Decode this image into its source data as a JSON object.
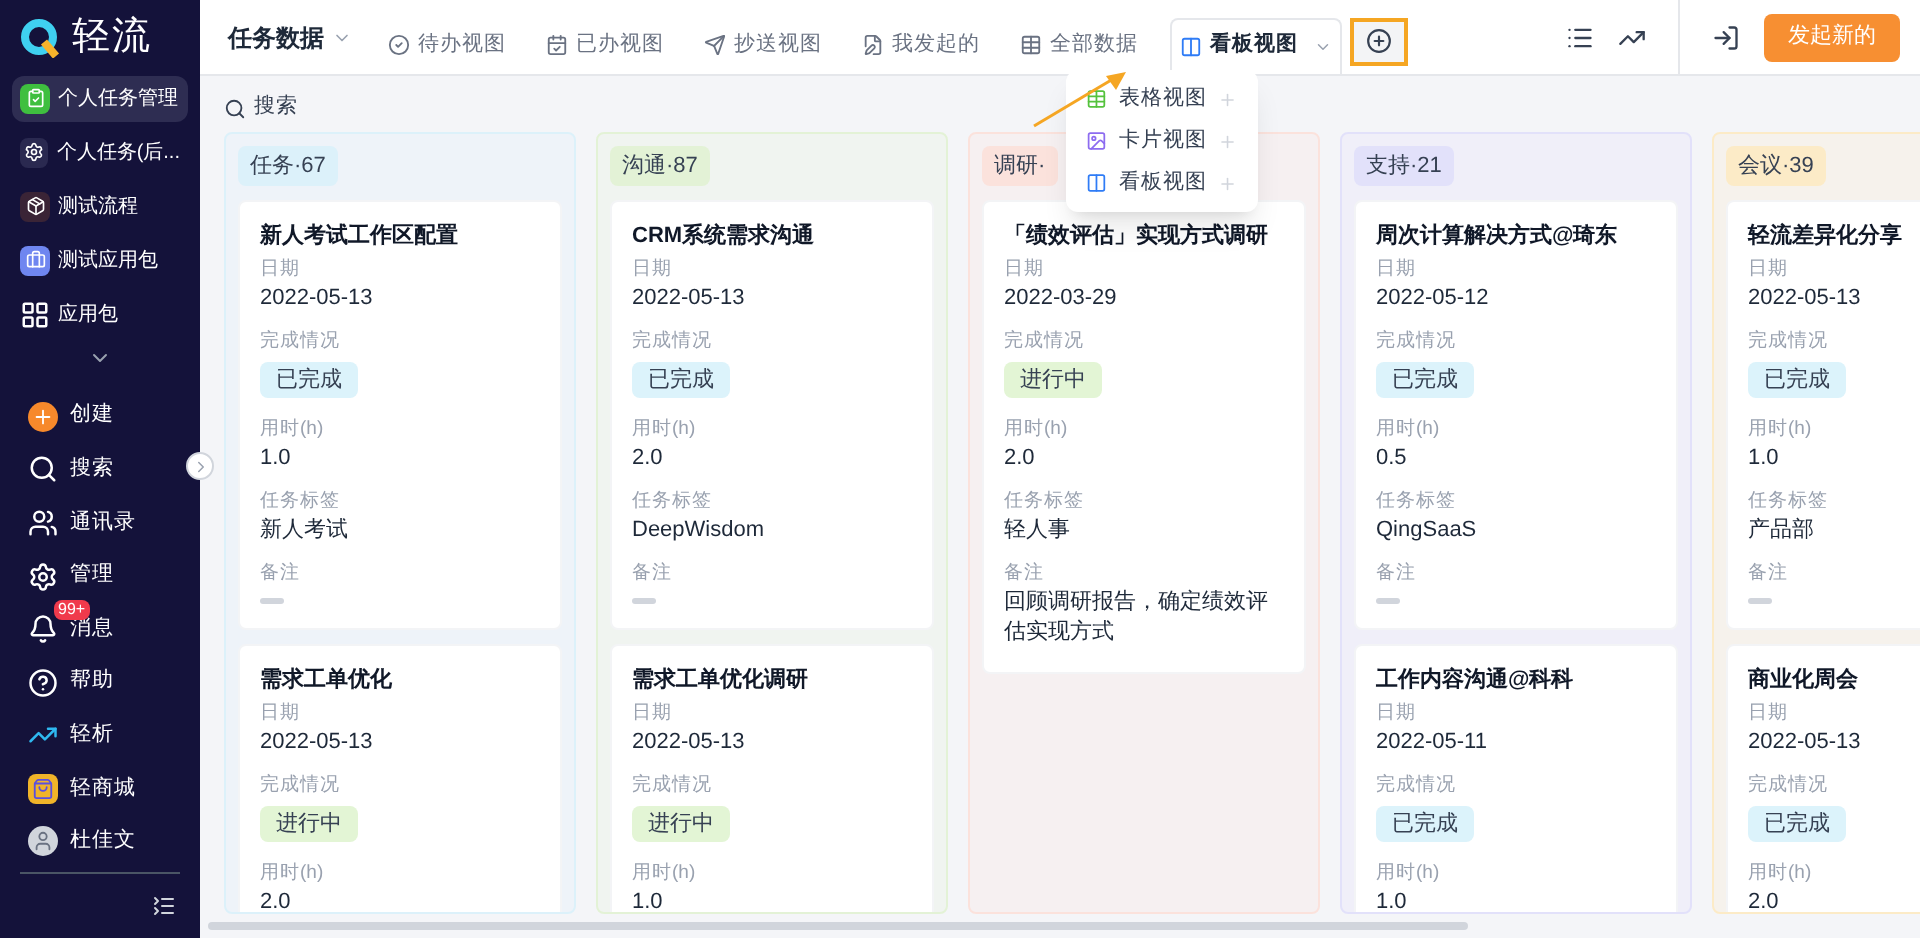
{
  "logo": {
    "text": "轻流"
  },
  "sidebar": {
    "items": [
      {
        "label": "个人任务管理",
        "kind": "app",
        "selected": true
      },
      {
        "label": "个人任务(后...",
        "kind": "app",
        "selected": false
      },
      {
        "label": "测试流程",
        "kind": "app",
        "selected": false
      },
      {
        "label": "测试应用包",
        "kind": "app",
        "selected": false
      },
      {
        "label": "应用包",
        "kind": "nav",
        "selected": false
      }
    ],
    "nav": [
      {
        "label": "创建"
      },
      {
        "label": "搜索"
      },
      {
        "label": "通讯录"
      },
      {
        "label": "管理"
      },
      {
        "label": "消息",
        "badge": "99+"
      },
      {
        "label": "帮助"
      },
      {
        "label": "轻析"
      },
      {
        "label": "轻商城"
      },
      {
        "label": "杜佳文"
      }
    ]
  },
  "toolbar": {
    "title": "任务数据",
    "tabs": [
      {
        "label": "待办视图",
        "selected": false
      },
      {
        "label": "已办视图",
        "selected": false
      },
      {
        "label": "抄送视图",
        "selected": false
      },
      {
        "label": "我发起的",
        "selected": false
      },
      {
        "label": "全部数据",
        "selected": false
      },
      {
        "label": "看板视图",
        "selected": true
      }
    ],
    "primary_button": "发起新的"
  },
  "add_view_menu": {
    "items": [
      {
        "label": "表格视图"
      },
      {
        "label": "卡片视图"
      },
      {
        "label": "看板视图"
      }
    ]
  },
  "search": {
    "placeholder": "搜索"
  },
  "board": {
    "columns": [
      {
        "label": "任务·67",
        "color": "#dcf1fa",
        "cards": [
          {
            "title": "新人考试工作区配置",
            "fields": [
              {
                "label": "日期",
                "value": "2022-05-13",
                "kind": "text"
              },
              {
                "label": "完成情况",
                "value": "已完成",
                "kind": "status",
                "color": "#dcf3fb"
              },
              {
                "label": "用时(h)",
                "value": "1.0",
                "kind": "text"
              },
              {
                "label": "任务标签",
                "value": "新人考试",
                "kind": "text"
              },
              {
                "label": "备注",
                "kind": "empty"
              }
            ]
          },
          {
            "title": "需求工单优化",
            "fields": [
              {
                "label": "日期",
                "value": "2022-05-13",
                "kind": "text"
              },
              {
                "label": "完成情况",
                "value": "进行中",
                "kind": "status",
                "color": "#e3f5d5"
              },
              {
                "label": "用时(h)",
                "value": "2.0",
                "kind": "text"
              }
            ]
          }
        ]
      },
      {
        "label": "沟通·87",
        "color": "#e3f2d6",
        "cards": [
          {
            "title": "CRM系统需求沟通",
            "fields": [
              {
                "label": "日期",
                "value": "2022-05-13",
                "kind": "text"
              },
              {
                "label": "完成情况",
                "value": "已完成",
                "kind": "status",
                "color": "#dcf3fb"
              },
              {
                "label": "用时(h)",
                "value": "2.0",
                "kind": "text"
              },
              {
                "label": "任务标签",
                "value": "DeepWisdom",
                "kind": "text"
              },
              {
                "label": "备注",
                "kind": "empty"
              }
            ]
          },
          {
            "title": "需求工单优化调研",
            "fields": [
              {
                "label": "日期",
                "value": "2022-05-13",
                "kind": "text"
              },
              {
                "label": "完成情况",
                "value": "进行中",
                "kind": "status",
                "color": "#e3f5d5"
              },
              {
                "label": "用时(h)",
                "value": "1.0",
                "kind": "text"
              }
            ]
          }
        ]
      },
      {
        "label": "调研·",
        "color": "#fbe2dc",
        "cards": [
          {
            "title": "「绩效评估」实现方式调研",
            "fields": [
              {
                "label": "日期",
                "value": "2022-03-29",
                "kind": "text"
              },
              {
                "label": "完成情况",
                "value": "进行中",
                "kind": "status",
                "color": "#e3f5d5"
              },
              {
                "label": "用时(h)",
                "value": "2.0",
                "kind": "text"
              },
              {
                "label": "任务标签",
                "value": "轻人事",
                "kind": "text"
              },
              {
                "label": "备注",
                "value": "回顾调研报告，确定绩效评估实现方式",
                "kind": "text"
              }
            ]
          }
        ]
      },
      {
        "label": "支持·21",
        "color": "#e2e1fa",
        "cards": [
          {
            "title": "周次计算解决方式@琦东",
            "fields": [
              {
                "label": "日期",
                "value": "2022-05-12",
                "kind": "text"
              },
              {
                "label": "完成情况",
                "value": "已完成",
                "kind": "status",
                "color": "#dcf3fb"
              },
              {
                "label": "用时(h)",
                "value": "0.5",
                "kind": "text"
              },
              {
                "label": "任务标签",
                "value": "QingSaaS",
                "kind": "text"
              },
              {
                "label": "备注",
                "kind": "empty"
              }
            ]
          },
          {
            "title": "工作内容沟通@科科",
            "fields": [
              {
                "label": "日期",
                "value": "2022-05-11",
                "kind": "text"
              },
              {
                "label": "完成情况",
                "value": "已完成",
                "kind": "status",
                "color": "#dcf3fb"
              },
              {
                "label": "用时(h)",
                "value": "1.0",
                "kind": "text"
              }
            ]
          }
        ]
      },
      {
        "label": "会议·39",
        "color": "#fcebc7",
        "cards": [
          {
            "title": "轻流差异化分享",
            "fields": [
              {
                "label": "日期",
                "value": "2022-05-13",
                "kind": "text"
              },
              {
                "label": "完成情况",
                "value": "已完成",
                "kind": "status",
                "color": "#dcf3fb"
              },
              {
                "label": "用时(h)",
                "value": "1.0",
                "kind": "text"
              },
              {
                "label": "任务标签",
                "value": "产品部",
                "kind": "text"
              },
              {
                "label": "备注",
                "kind": "empty"
              }
            ]
          },
          {
            "title": "商业化周会",
            "fields": [
              {
                "label": "日期",
                "value": "2022-05-13",
                "kind": "text"
              },
              {
                "label": "完成情况",
                "value": "已完成",
                "kind": "status",
                "color": "#dcf3fb"
              },
              {
                "label": "用时(h)",
                "value": "2.0",
                "kind": "text"
              }
            ]
          }
        ]
      }
    ]
  }
}
